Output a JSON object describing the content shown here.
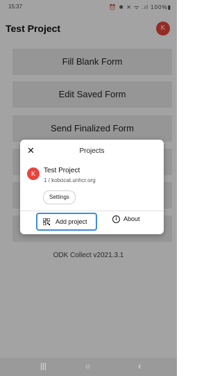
{
  "status_bar": {
    "time": "15:37",
    "icons": "⏰ ✱ ✕ ᯤ .ıl 100%▮"
  },
  "app_bar": {
    "title": "Test Project",
    "avatar_letter": "K"
  },
  "main_buttons": [
    {
      "label": "Fill Blank Form"
    },
    {
      "label": "Edit Saved Form"
    },
    {
      "label": "Send Finalized Form"
    }
  ],
  "version": "ODK Collect v2021.3.1",
  "dialog": {
    "title": "Projects",
    "close_icon": "close-icon",
    "project": {
      "avatar_letter": "K",
      "name": "Test Project",
      "subtitle": "1 / kobocat.unhcr.org"
    },
    "settings_label": "Settings",
    "add_project_label": "Add project",
    "about_label": "About"
  },
  "nav_bar": {
    "recents": "|||",
    "home": "○",
    "back": "‹"
  },
  "colors": {
    "accent": "#e8453c",
    "focus_border": "#3b8fd9"
  }
}
